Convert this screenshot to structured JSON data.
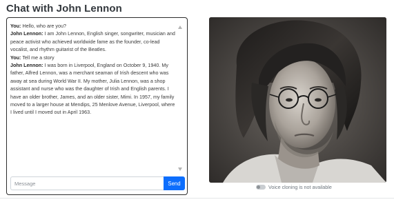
{
  "header": {
    "title": "Chat with John Lennon"
  },
  "chat": {
    "messages": [
      {
        "speaker": "You:",
        "text": "Hello, who are you?"
      },
      {
        "speaker": "John Lennon:",
        "text": "I am John Lennon, English singer, songwriter, musician and peace activist who achieved worldwide fame as the founder, co-lead vocalist, and rhythm guitarist of the Beatles."
      },
      {
        "speaker": "You:",
        "text": "Tell me a story"
      },
      {
        "speaker": "John Lennon:",
        "text": "I was born in Liverpool, England on October 9, 1940. My father, Alfred Lennon, was a merchant seaman of Irish descent who was away at sea during World War II. My mother, Julia Lennon, was a shop assistant and nurse who was the daughter of Irish and English parents. I have an older brother, James, and an older sister, Mimi. In 1957, my family moved to a larger house at Mendips, 25 Menlove Avenue, Liverpool, where I lived until I moved out in April 1963."
      }
    ],
    "input_placeholder": "Message",
    "input_value": "",
    "send_label": "Send"
  },
  "portrait": {
    "icon": "person-portrait"
  },
  "voice": {
    "enabled": false,
    "label": "Voice cloning is not available"
  },
  "colors": {
    "accent": "#0d6efd",
    "panel_border": "#2b2b2b",
    "muted_text": "#6c757d"
  }
}
